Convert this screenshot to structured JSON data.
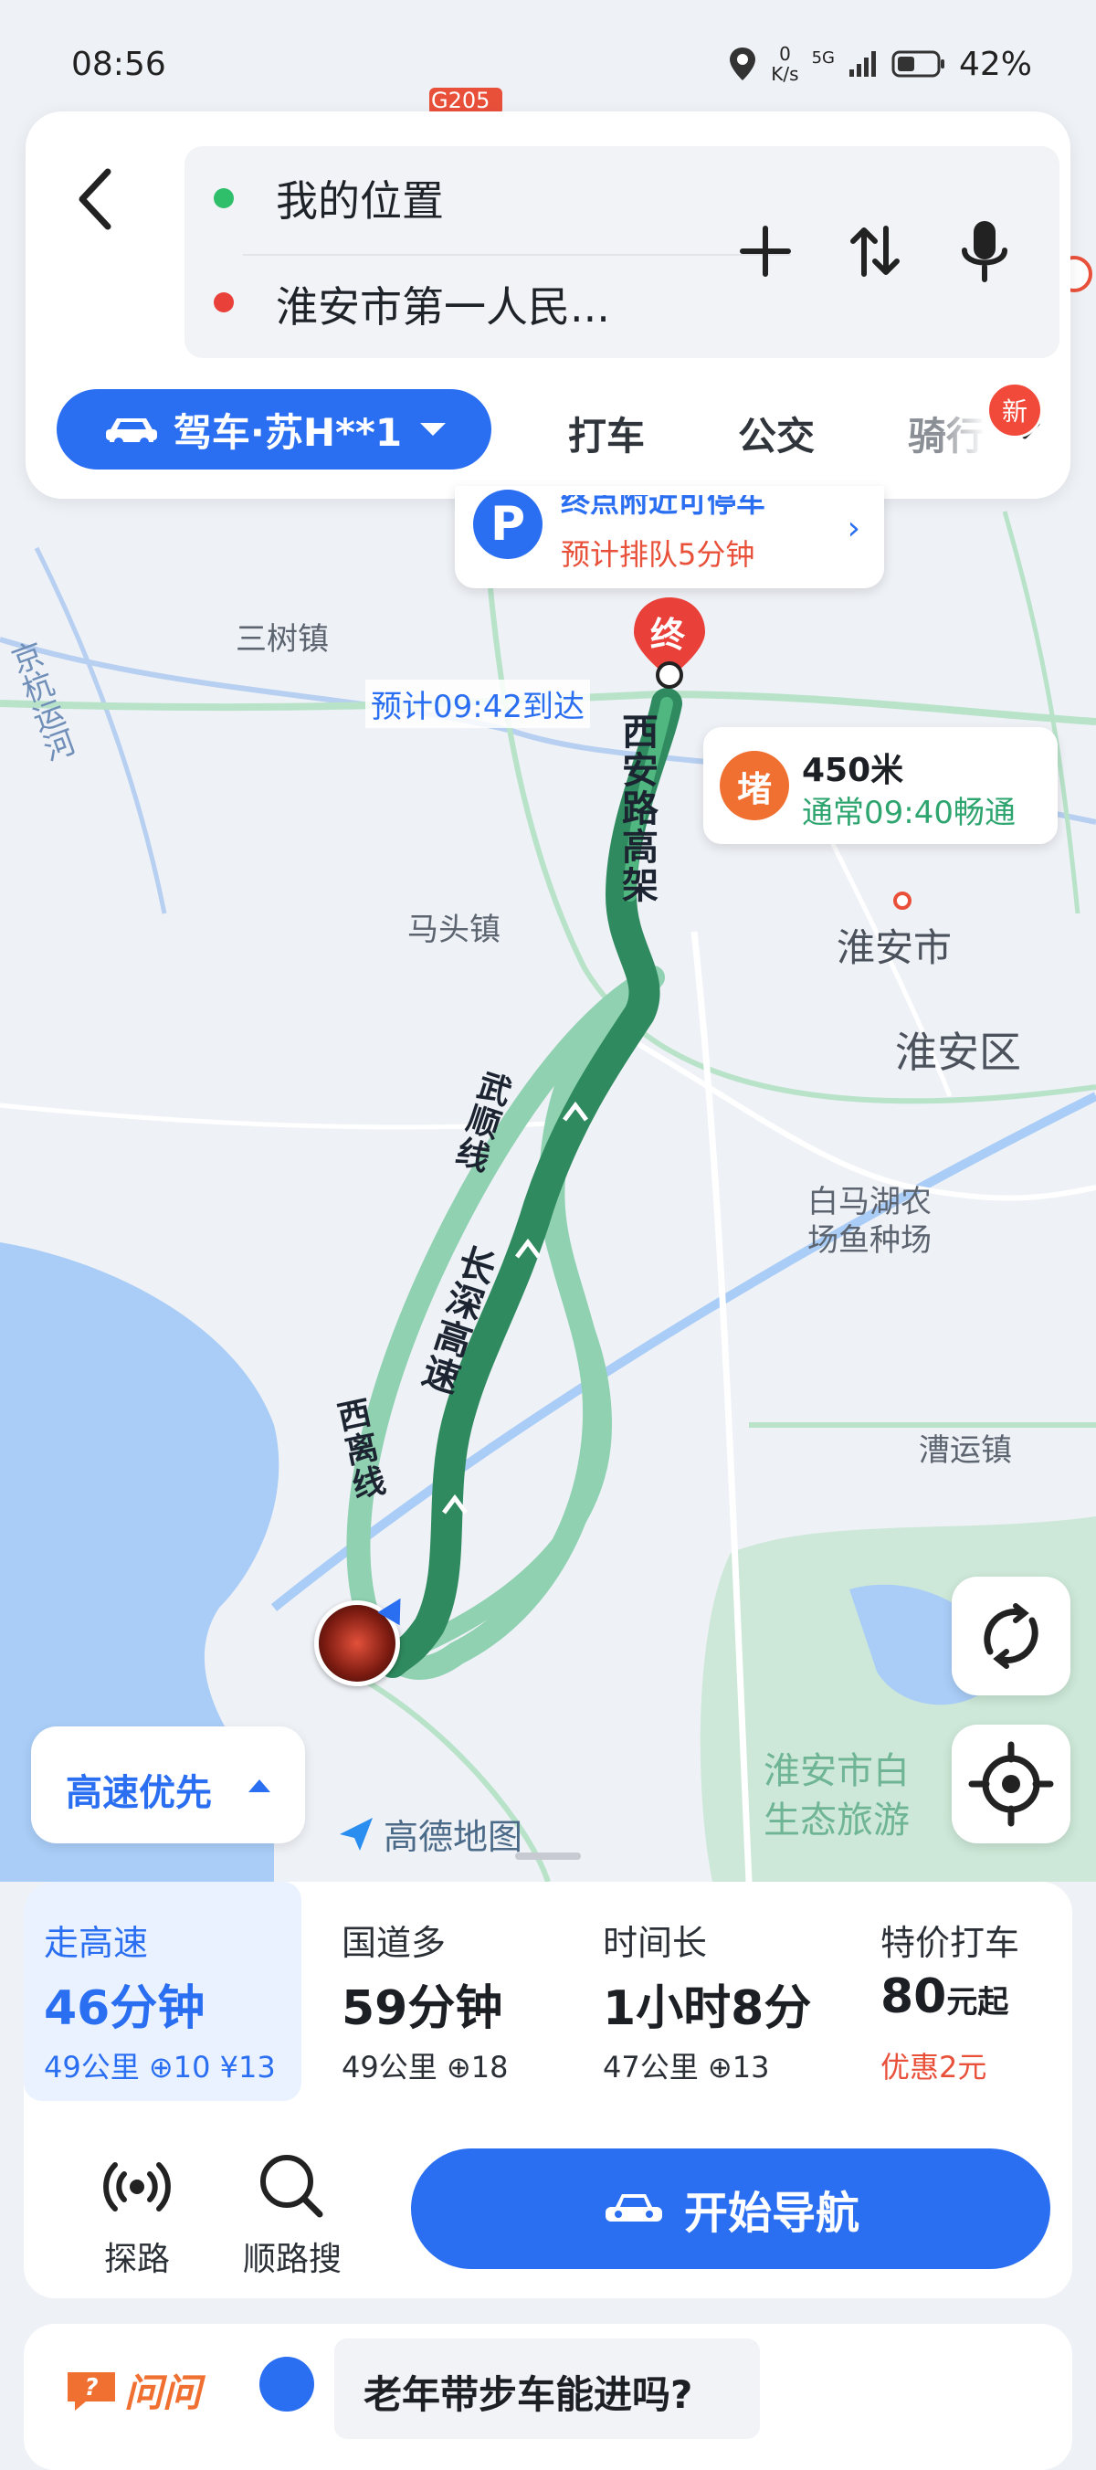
{
  "status_bar": {
    "time": "08:56",
    "net_speed": "0",
    "net_unit": "K/s",
    "signal": "5G",
    "battery": "42%"
  },
  "search": {
    "origin": "我的位置",
    "destination": "淮安市第一人民..."
  },
  "modes": {
    "drive_label": "驾车·苏H**1",
    "taxi": "打车",
    "transit": "公交",
    "ride": "骑行",
    "new_badge": "新"
  },
  "map": {
    "parking_title": "终点附近可停车",
    "parking_queue": "预计排队5分钟",
    "dest_marker": "终",
    "eta_label": "预计09:42到达",
    "jam_icon": "堵",
    "jam_distance": "450米",
    "jam_status": "通常09:40畅通",
    "labels": {
      "sanshu": "三树镇",
      "matou": "马头镇",
      "huaian_city": "淮安市",
      "huaian_district": "淮安区",
      "baimahu": "白马湖农",
      "baimahu2": "场鱼种场",
      "caoyun": "漕运镇",
      "jinghang": "京杭运河",
      "wetland1": "淮安市白",
      "wetland2": "生态旅游",
      "g205": "G205"
    },
    "roads": {
      "xian": "西安路高架",
      "wushun": "武顺线",
      "changshen": "长深高速",
      "xili": "西离线"
    },
    "prefer": "高速优先",
    "logo": "高德地图"
  },
  "routes": [
    {
      "name": "走高速",
      "duration": "46分钟",
      "meta": "49公里 ⊕10 ¥13",
      "selected": true
    },
    {
      "name": "国道多",
      "duration": "59分钟",
      "meta": "49公里 ⊕18"
    },
    {
      "name": "时间长",
      "duration": "1小时8分",
      "meta": "47公里 ⊕13"
    },
    {
      "name": "特价打车",
      "duration": "80",
      "duration_unit": "元起",
      "meta": "优惠2元"
    }
  ],
  "tools": {
    "explore": "探路",
    "along_search": "顺路搜",
    "start_nav": "开始导航"
  },
  "ask": {
    "brand": "问问",
    "question": "老年带步车能进吗?"
  },
  "colors": {
    "accent": "#2a6ef1",
    "route_green": "#2f8a5f",
    "alt_route": "#8fd1b1",
    "alert_orange": "#f07031",
    "dest_red": "#e9403a"
  }
}
